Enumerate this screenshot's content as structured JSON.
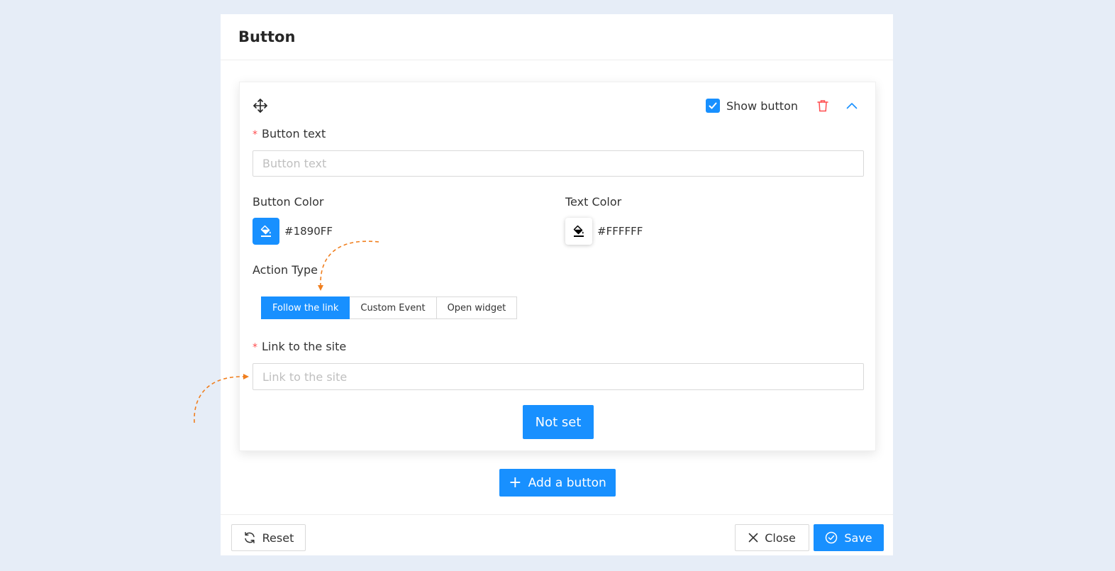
{
  "panel": {
    "title": "Button"
  },
  "card": {
    "show_button_label": "Show button",
    "show_button_checked": true,
    "button_text": {
      "label": "Button text",
      "required_mark": "*",
      "placeholder": "Button text",
      "value": ""
    },
    "button_color": {
      "label": "Button Color",
      "hex": "#1890FF"
    },
    "text_color": {
      "label": "Text Color",
      "hex": "#FFFFFF"
    },
    "action_type": {
      "label": "Action Type",
      "options": [
        "Follow the link",
        "Custom Event",
        "Open widget"
      ],
      "selected": "Follow the link"
    },
    "link": {
      "label": "Link to the site",
      "required_mark": "*",
      "placeholder": "Link to the site",
      "value": ""
    },
    "preview_button_label": "Not set"
  },
  "add_button_label": "Add a button",
  "footer": {
    "reset_label": "Reset",
    "close_label": "Close",
    "save_label": "Save"
  },
  "icons": {
    "drag": "move-icon",
    "trash": "trash-icon",
    "collapse": "chevron-up-icon",
    "fill": "paint-bucket-icon",
    "reset": "refresh-icon",
    "close": "close-icon",
    "save": "check-circle-icon",
    "add": "plus-icon"
  },
  "colors": {
    "accent": "#1890ff",
    "danger": "#ff4d4f",
    "annotation": "#f07f1f",
    "background": "#e6edf7"
  }
}
